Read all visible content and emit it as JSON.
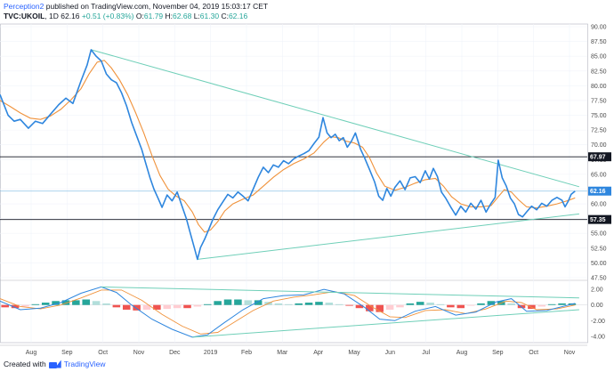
{
  "header": {
    "author": "Perception2",
    "published_text": "published on TradingView.com, November 04, 2019 15:03:17 CET",
    "ticker": "TVC:UKOIL",
    "interval": "1D",
    "last": "62.16",
    "change": "+0.51 (+0.83%)",
    "o_label": "O:",
    "o_val": "61.79",
    "h_label": "H:",
    "h_val": "62.68",
    "l_label": "L:",
    "l_val": "61.30",
    "c_label": "C:",
    "c_val": "62.16"
  },
  "footer": {
    "created_with": "Created with",
    "brand": "TradingView"
  },
  "colors": {
    "price": "#2e86de",
    "ma": "#f0923b",
    "trendline": "#6fcfb8",
    "level": "#131722",
    "last_line": "#8fc4e6",
    "last_badge": "#2e86de",
    "hist_up": "#26a69a",
    "hist_up_light": "#b2dfdb",
    "hist_down": "#ef5350",
    "hist_down_light": "#ffcdd2"
  },
  "chart_data": {
    "type": "line",
    "x_tick_labels": [
      "Aug",
      "Sep",
      "Oct",
      "Nov",
      "Dec",
      "2019",
      "Feb",
      "Mar",
      "Apr",
      "May",
      "Jun",
      "Jul",
      "Aug",
      "Sep",
      "Oct",
      "Nov"
    ],
    "price_axis": {
      "ylim": [
        47.5,
        90.0
      ],
      "tick_labels": [
        "90.00",
        "87.50",
        "85.00",
        "82.50",
        "80.00",
        "77.50",
        "75.00",
        "72.50",
        "70.00",
        "67.50",
        "65.00",
        "62.50",
        "60.00",
        "57.50",
        "55.00",
        "52.50",
        "50.00",
        "47.50"
      ]
    },
    "levels": [
      {
        "label": "67.97",
        "value": 67.97
      },
      {
        "label": "57.35",
        "value": 57.35
      }
    ],
    "last_price": {
      "label": "62.16",
      "value": 62.16
    },
    "price_series": {
      "name": "",
      "points": [
        [
          0.0,
          78.5
        ],
        [
          0.8,
          75.0
        ],
        [
          1.4,
          74.0
        ],
        [
          2.0,
          74.3
        ],
        [
          2.8,
          72.8
        ],
        [
          3.5,
          74.0
        ],
        [
          4.2,
          73.6
        ],
        [
          5.0,
          75.2
        ],
        [
          5.8,
          76.8
        ],
        [
          6.5,
          77.9
        ],
        [
          7.2,
          77.0
        ],
        [
          8.0,
          80.8
        ],
        [
          8.6,
          83.5
        ],
        [
          9.0,
          86.1
        ],
        [
          9.5,
          85.0
        ],
        [
          10.0,
          84.2
        ],
        [
          10.5,
          82.0
        ],
        [
          11.0,
          81.0
        ],
        [
          11.5,
          80.5
        ],
        [
          12.0,
          78.8
        ],
        [
          12.5,
          76.6
        ],
        [
          13.0,
          73.8
        ],
        [
          13.5,
          71.5
        ],
        [
          14.0,
          69.2
        ],
        [
          14.4,
          66.8
        ],
        [
          14.8,
          64.5
        ],
        [
          15.2,
          62.5
        ],
        [
          15.6,
          61.0
        ],
        [
          16.0,
          59.4
        ],
        [
          16.5,
          61.5
        ],
        [
          17.0,
          60.5
        ],
        [
          17.5,
          62.0
        ],
        [
          18.0,
          59.5
        ],
        [
          18.4,
          57.5
        ],
        [
          18.8,
          55.0
        ],
        [
          19.2,
          52.5
        ],
        [
          19.5,
          50.6
        ],
        [
          19.8,
          52.6
        ],
        [
          20.2,
          54.0
        ],
        [
          20.6,
          55.6
        ],
        [
          21.0,
          57.3
        ],
        [
          21.5,
          59.0
        ],
        [
          22.0,
          60.3
        ],
        [
          22.5,
          61.6
        ],
        [
          23.0,
          61.0
        ],
        [
          23.5,
          62.0
        ],
        [
          24.0,
          61.3
        ],
        [
          24.5,
          60.5
        ],
        [
          25.0,
          62.5
        ],
        [
          25.5,
          64.5
        ],
        [
          26.0,
          66.2
        ],
        [
          26.5,
          65.3
        ],
        [
          27.0,
          66.6
        ],
        [
          27.5,
          66.2
        ],
        [
          28.0,
          67.3
        ],
        [
          28.5,
          66.8
        ],
        [
          29.0,
          67.6
        ],
        [
          29.5,
          68.1
        ],
        [
          30.0,
          68.5
        ],
        [
          30.5,
          69.0
        ],
        [
          31.0,
          70.2
        ],
        [
          31.5,
          71.3
        ],
        [
          31.9,
          74.6
        ],
        [
          32.3,
          72.0
        ],
        [
          32.7,
          71.2
        ],
        [
          33.1,
          71.8
        ],
        [
          33.5,
          70.7
        ],
        [
          33.9,
          71.2
        ],
        [
          34.3,
          69.6
        ],
        [
          34.7,
          70.6
        ],
        [
          35.1,
          72.0
        ],
        [
          35.6,
          69.3
        ],
        [
          36.0,
          67.8
        ],
        [
          36.5,
          65.8
        ],
        [
          37.0,
          63.7
        ],
        [
          37.4,
          61.3
        ],
        [
          37.8,
          60.6
        ],
        [
          38.2,
          62.6
        ],
        [
          38.6,
          61.3
        ],
        [
          39.0,
          62.8
        ],
        [
          39.5,
          63.9
        ],
        [
          40.0,
          62.4
        ],
        [
          40.5,
          64.4
        ],
        [
          41.0,
          64.6
        ],
        [
          41.5,
          63.6
        ],
        [
          42.0,
          65.6
        ],
        [
          42.4,
          64.2
        ],
        [
          42.8,
          66.0
        ],
        [
          43.2,
          64.6
        ],
        [
          43.6,
          62.0
        ],
        [
          44.0,
          61.0
        ],
        [
          44.5,
          59.5
        ],
        [
          45.0,
          58.1
        ],
        [
          45.5,
          59.6
        ],
        [
          46.0,
          58.6
        ],
        [
          46.5,
          60.1
        ],
        [
          47.0,
          59.1
        ],
        [
          47.5,
          60.6
        ],
        [
          48.0,
          58.6
        ],
        [
          48.5,
          60.1
        ],
        [
          48.9,
          61.1
        ],
        [
          49.2,
          67.4
        ],
        [
          49.6,
          64.4
        ],
        [
          50.0,
          63.0
        ],
        [
          50.4,
          61.0
        ],
        [
          50.8,
          60.0
        ],
        [
          51.2,
          58.2
        ],
        [
          51.6,
          57.8
        ],
        [
          52.0,
          58.6
        ],
        [
          52.5,
          59.6
        ],
        [
          53.0,
          59.0
        ],
        [
          53.5,
          60.1
        ],
        [
          54.0,
          59.6
        ],
        [
          54.5,
          60.6
        ],
        [
          55.0,
          61.1
        ],
        [
          55.5,
          60.6
        ],
        [
          55.8,
          59.5
        ],
        [
          56.1,
          60.4
        ],
        [
          56.4,
          61.6
        ],
        [
          56.8,
          62.16
        ]
      ]
    },
    "ma_series": {
      "name": "",
      "points": [
        [
          0.0,
          77.5
        ],
        [
          1.0,
          76.5
        ],
        [
          2.0,
          75.4
        ],
        [
          3.0,
          74.5
        ],
        [
          4.0,
          74.3
        ],
        [
          5.0,
          74.9
        ],
        [
          6.0,
          76.0
        ],
        [
          7.0,
          77.6
        ],
        [
          8.0,
          79.5
        ],
        [
          8.8,
          82.0
        ],
        [
          9.6,
          84.0
        ],
        [
          10.3,
          84.3
        ],
        [
          11.0,
          83.0
        ],
        [
          11.8,
          81.0
        ],
        [
          12.6,
          78.5
        ],
        [
          13.4,
          75.4
        ],
        [
          14.2,
          72.0
        ],
        [
          15.0,
          68.2
        ],
        [
          15.8,
          64.8
        ],
        [
          16.6,
          62.5
        ],
        [
          17.4,
          61.3
        ],
        [
          18.2,
          60.5
        ],
        [
          19.0,
          58.6
        ],
        [
          19.6,
          56.5
        ],
        [
          20.2,
          55.2
        ],
        [
          20.8,
          55.6
        ],
        [
          21.5,
          57.0
        ],
        [
          22.2,
          58.8
        ],
        [
          23.0,
          60.0
        ],
        [
          24.0,
          60.8
        ],
        [
          25.0,
          61.5
        ],
        [
          26.0,
          63.0
        ],
        [
          27.0,
          64.5
        ],
        [
          28.0,
          65.8
        ],
        [
          29.0,
          66.8
        ],
        [
          30.0,
          67.6
        ],
        [
          31.0,
          68.6
        ],
        [
          32.0,
          70.5
        ],
        [
          32.6,
          71.4
        ],
        [
          33.4,
          71.2
        ],
        [
          34.2,
          70.6
        ],
        [
          35.0,
          70.3
        ],
        [
          35.8,
          69.6
        ],
        [
          36.5,
          67.8
        ],
        [
          37.2,
          65.2
        ],
        [
          38.0,
          63.0
        ],
        [
          39.0,
          62.3
        ],
        [
          40.0,
          62.8
        ],
        [
          41.0,
          63.5
        ],
        [
          42.0,
          64.1
        ],
        [
          43.0,
          64.3
        ],
        [
          43.8,
          63.0
        ],
        [
          44.6,
          61.2
        ],
        [
          45.5,
          60.0
        ],
        [
          46.5,
          59.5
        ],
        [
          47.5,
          59.5
        ],
        [
          48.5,
          59.7
        ],
        [
          49.2,
          61.2
        ],
        [
          49.8,
          62.4
        ],
        [
          50.5,
          62.0
        ],
        [
          51.2,
          60.7
        ],
        [
          52.0,
          59.5
        ],
        [
          53.0,
          59.3
        ],
        [
          54.0,
          59.6
        ],
        [
          55.0,
          60.0
        ],
        [
          56.0,
          60.5
        ],
        [
          56.8,
          61.0
        ]
      ]
    },
    "trendlines": [
      {
        "from": [
          9.0,
          86.1
        ],
        "to": [
          57.2,
          62.9
        ]
      },
      {
        "from": [
          19.5,
          50.6
        ],
        "to": [
          57.2,
          58.3
        ]
      }
    ],
    "oscillator": {
      "ylim": [
        -4.8,
        2.8
      ],
      "tick_labels": [
        "2.00",
        "0.00",
        "-2.00",
        "-4.00"
      ],
      "line_a": [
        [
          0.0,
          0.5
        ],
        [
          2.0,
          -0.6
        ],
        [
          4.0,
          -0.4
        ],
        [
          6.0,
          0.3
        ],
        [
          8.0,
          1.5
        ],
        [
          10.0,
          2.3
        ],
        [
          11.5,
          1.6
        ],
        [
          13.0,
          0.0
        ],
        [
          15.0,
          -1.8
        ],
        [
          17.0,
          -3.1
        ],
        [
          19.0,
          -4.1
        ],
        [
          20.5,
          -3.8
        ],
        [
          22.0,
          -2.4
        ],
        [
          24.0,
          -0.6
        ],
        [
          26.0,
          0.8
        ],
        [
          28.0,
          1.2
        ],
        [
          30.0,
          1.3
        ],
        [
          32.0,
          2.0
        ],
        [
          34.0,
          1.4
        ],
        [
          36.0,
          -0.3
        ],
        [
          37.5,
          -1.8
        ],
        [
          39.0,
          -2.0
        ],
        [
          41.0,
          -0.8
        ],
        [
          43.0,
          -0.2
        ],
        [
          45.0,
          -1.3
        ],
        [
          47.0,
          -0.9
        ],
        [
          49.0,
          0.4
        ],
        [
          50.5,
          0.8
        ],
        [
          52.0,
          -0.8
        ],
        [
          54.0,
          -0.7
        ],
        [
          56.8,
          0.2
        ]
      ],
      "line_b": [
        [
          0.0,
          0.8
        ],
        [
          2.0,
          -0.2
        ],
        [
          4.0,
          -0.5
        ],
        [
          6.0,
          0.0
        ],
        [
          8.0,
          0.9
        ],
        [
          10.0,
          1.9
        ],
        [
          12.0,
          1.9
        ],
        [
          14.0,
          0.6
        ],
        [
          16.0,
          -1.2
        ],
        [
          18.0,
          -2.7
        ],
        [
          19.8,
          -3.7
        ],
        [
          21.5,
          -3.5
        ],
        [
          23.0,
          -2.3
        ],
        [
          25.0,
          -0.7
        ],
        [
          27.0,
          0.5
        ],
        [
          29.0,
          1.0
        ],
        [
          31.0,
          1.3
        ],
        [
          33.0,
          1.7
        ],
        [
          35.0,
          1.2
        ],
        [
          36.8,
          -0.3
        ],
        [
          38.5,
          -1.5
        ],
        [
          40.0,
          -1.6
        ],
        [
          42.0,
          -0.7
        ],
        [
          44.0,
          -0.6
        ],
        [
          46.0,
          -1.1
        ],
        [
          48.0,
          -0.5
        ],
        [
          50.0,
          0.5
        ],
        [
          51.5,
          0.3
        ],
        [
          53.0,
          -0.6
        ],
        [
          55.0,
          -0.5
        ],
        [
          56.8,
          0.0
        ]
      ],
      "histogram": [
        [
          0.5,
          -0.3
        ],
        [
          1.5,
          -0.4
        ],
        [
          2.5,
          -0.2
        ],
        [
          3.5,
          0.1
        ],
        [
          4.5,
          0.3
        ],
        [
          5.5,
          0.5
        ],
        [
          6.5,
          0.6
        ],
        [
          7.5,
          0.6
        ],
        [
          8.5,
          0.7
        ],
        [
          9.5,
          0.5
        ],
        [
          10.5,
          0.2
        ],
        [
          11.5,
          -0.3
        ],
        [
          12.5,
          -0.6
        ],
        [
          13.5,
          -0.7
        ],
        [
          14.5,
          -0.6
        ],
        [
          15.5,
          -0.6
        ],
        [
          16.5,
          -0.5
        ],
        [
          17.5,
          -0.4
        ],
        [
          18.5,
          -0.4
        ],
        [
          19.5,
          -0.2
        ],
        [
          20.5,
          0.1
        ],
        [
          21.5,
          0.5
        ],
        [
          22.5,
          0.7
        ],
        [
          23.5,
          0.7
        ],
        [
          24.5,
          0.6
        ],
        [
          25.5,
          0.6
        ],
        [
          26.5,
          0.4
        ],
        [
          27.5,
          0.2
        ],
        [
          28.5,
          0.1
        ],
        [
          29.5,
          0.2
        ],
        [
          30.5,
          0.3
        ],
        [
          31.5,
          0.4
        ],
        [
          32.5,
          0.3
        ],
        [
          33.5,
          0.1
        ],
        [
          34.5,
          -0.1
        ],
        [
          35.5,
          -0.4
        ],
        [
          36.5,
          -0.8
        ],
        [
          37.5,
          -0.9
        ],
        [
          38.5,
          -0.6
        ],
        [
          39.5,
          -0.3
        ],
        [
          40.5,
          0.2
        ],
        [
          41.5,
          0.4
        ],
        [
          42.5,
          0.3
        ],
        [
          43.5,
          0.1
        ],
        [
          44.5,
          -0.3
        ],
        [
          45.5,
          -0.4
        ],
        [
          46.5,
          -0.1
        ],
        [
          47.5,
          0.2
        ],
        [
          48.5,
          0.5
        ],
        [
          49.5,
          0.5
        ],
        [
          50.5,
          0.2
        ],
        [
          51.5,
          -0.4
        ],
        [
          52.5,
          -0.5
        ],
        [
          53.5,
          -0.2
        ],
        [
          54.5,
          0.1
        ],
        [
          55.5,
          0.2
        ],
        [
          56.5,
          0.2
        ]
      ],
      "trendlines": [
        {
          "from": [
            10.0,
            2.3
          ],
          "to": [
            57.2,
            0.9
          ]
        },
        {
          "from": [
            19.0,
            -4.1
          ],
          "to": [
            57.2,
            -0.6
          ]
        }
      ]
    }
  }
}
